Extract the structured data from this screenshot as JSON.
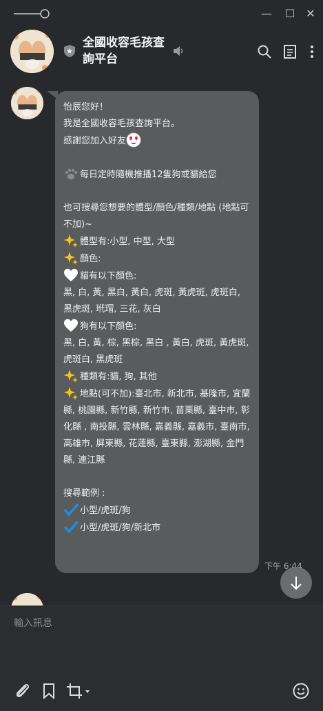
{
  "window": {
    "minimize_label": "—",
    "maximize_label": "☐",
    "close_label": "✕"
  },
  "header": {
    "title": "全國收容毛孩查詢平台"
  },
  "message": {
    "lines": [
      "怡辰您好！",
      "我是全國收容毛孩查詢平台。",
      "感謝您加入好友",
      "",
      "每日定時隨機推播12隻狗或貓給您",
      "",
      "也可搜尋您想要的體型/顏色/種類/地點 (地點可不加)~",
      "體型有:小型, 中型, 大型",
      "顏色:",
      "貓有以下顏色:",
      "黑, 白, 黃, 黑白, 黃白, 虎斑, 黃虎斑, 虎斑白, 黑虎斑, 玳瑁, 三花, 灰白",
      "狗有以下顏色:",
      "黑, 白, 黃, 棕, 黑棕, 黑白 , 黃白, 虎斑, 黃虎斑, 虎斑白, 黑虎斑",
      "種類有:貓, 狗, 其他",
      "地點(可不加):臺北市, 新北市, 基隆市, 宜蘭縣, 桃園縣, 新竹縣, 新竹市, 苗栗縣, 臺中市, 彰化縣 , 南投縣, 雲林縣, 嘉義縣, 嘉義市, 臺南市, 高雄市, 屏東縣, 花蓮縣, 臺東縣, 澎湖縣, 金門縣, 連江縣",
      "",
      "搜尋範例 :",
      "小型/虎斑/狗",
      "小型/虎斑/狗/新北市"
    ],
    "time": "下午 6:44"
  },
  "input": {
    "placeholder": "輸入訊息"
  },
  "colors": {
    "bubble": "#5a5b5d",
    "background": "#27292d",
    "check": "#1e8fe0",
    "sparkle": "#f5c518"
  }
}
